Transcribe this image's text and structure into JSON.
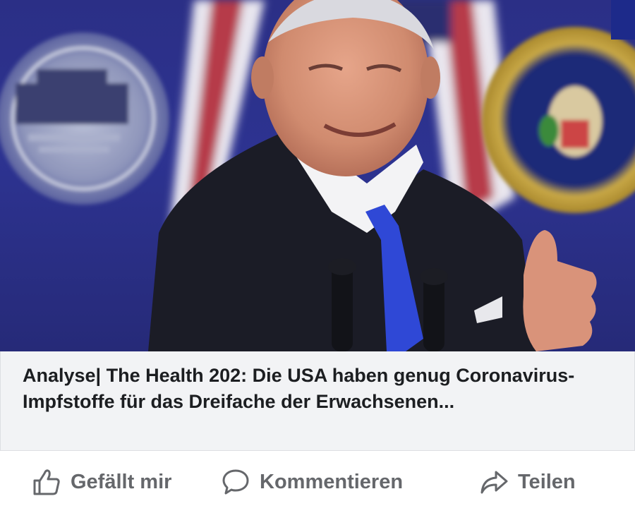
{
  "post": {
    "headline": "Analyse| The Health 202: Die USA haben genug Coronavirus-Impfstoffe für das Dreifache der Erwachsenen..."
  },
  "actions": {
    "like_label": "Gefällt mir",
    "comment_label": "Kommentieren",
    "share_label": "Teilen"
  },
  "icons": {
    "like": "thumbs-up-icon",
    "comment": "speech-bubble-icon",
    "share": "share-arrow-icon"
  },
  "colors": {
    "action_text": "#65676b",
    "headline_text": "#1c1e21",
    "caption_bg": "#f2f3f5",
    "photo_backdrop": "#2b2f86",
    "tie": "#2f48d6"
  }
}
